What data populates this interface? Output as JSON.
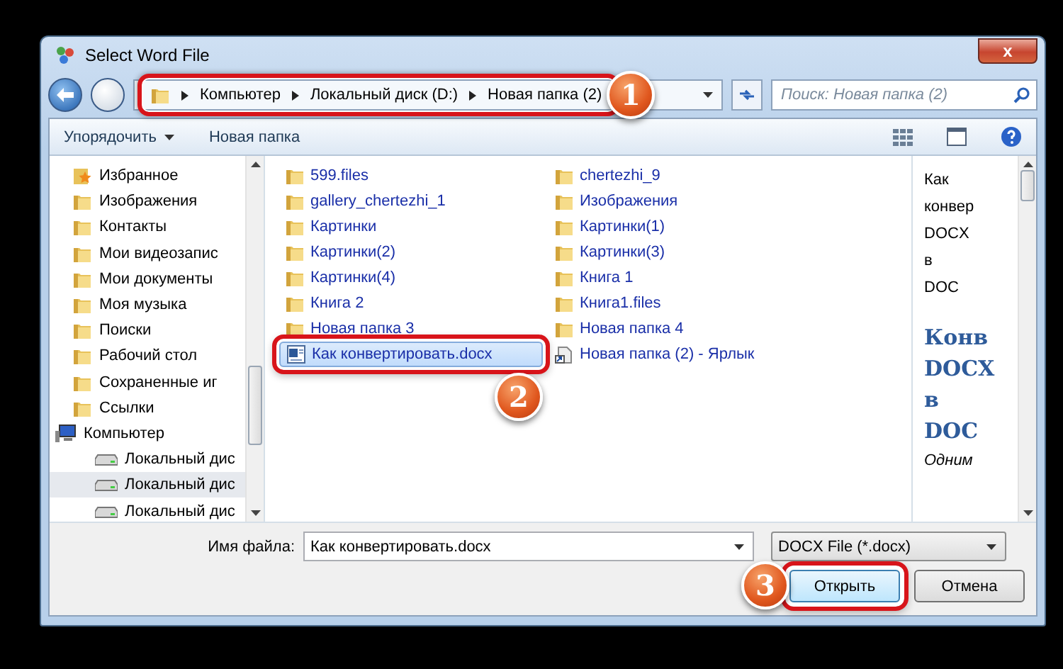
{
  "window": {
    "title": "Select Word File",
    "close": "x"
  },
  "nav": {
    "crumbs": [
      "Компьютер",
      "Локальный диск (D:)",
      "Новая папка (2)"
    ],
    "callout": "1",
    "search": {
      "placeholder": "Поиск: Новая папка (2)"
    }
  },
  "toolbar": {
    "organize": "Упорядочить",
    "new_folder": "Новая папка"
  },
  "sidebar": {
    "items": [
      {
        "label": "Избранное",
        "kind": "favorites",
        "selected": false
      },
      {
        "label": "Изображения",
        "kind": "folder",
        "selected": false
      },
      {
        "label": "Контакты",
        "kind": "folder",
        "selected": false
      },
      {
        "label": "Мои видеозапис",
        "kind": "folder",
        "selected": false
      },
      {
        "label": "Мои документы",
        "kind": "folder",
        "selected": false
      },
      {
        "label": "Моя музыка",
        "kind": "folder",
        "selected": false
      },
      {
        "label": "Поиски",
        "kind": "folder",
        "selected": false
      },
      {
        "label": "Рабочий стол",
        "kind": "folder",
        "selected": false
      },
      {
        "label": "Сохраненные иг",
        "kind": "folder",
        "selected": false
      },
      {
        "label": "Ссылки",
        "kind": "folder",
        "selected": false
      },
      {
        "label": "Компьютер",
        "kind": "computer",
        "selected": false,
        "children": [
          {
            "label": "Локальный дис",
            "kind": "drive",
            "selected": false
          },
          {
            "label": "Локальный дис",
            "kind": "drive",
            "selected": true
          },
          {
            "label": "Локальный дис",
            "kind": "drive",
            "selected": false
          }
        ]
      }
    ]
  },
  "files": [
    {
      "name": "599.files",
      "kind": "folder",
      "selected": false
    },
    {
      "name": "gallery_chertezhi_1",
      "kind": "folder",
      "selected": false
    },
    {
      "name": "Картинки",
      "kind": "folder",
      "selected": false
    },
    {
      "name": "Картинки(2)",
      "kind": "folder",
      "selected": false
    },
    {
      "name": "Картинки(4)",
      "kind": "folder",
      "selected": false
    },
    {
      "name": "Книга 2",
      "kind": "folder",
      "selected": false
    },
    {
      "name": "Новая папка 3",
      "kind": "folder",
      "selected": false
    },
    {
      "name": "Как конвертировать.docx",
      "kind": "document",
      "selected": true,
      "callout": "2"
    },
    {
      "name": "chertezhi_9",
      "kind": "folder",
      "selected": false
    },
    {
      "name": "Изображения",
      "kind": "folder",
      "selected": false
    },
    {
      "name": "Картинки(1)",
      "kind": "folder",
      "selected": false
    },
    {
      "name": "Картинки(3)",
      "kind": "folder",
      "selected": false
    },
    {
      "name": "Книга 1",
      "kind": "folder",
      "selected": false
    },
    {
      "name": "Книга1.files",
      "kind": "folder",
      "selected": false
    },
    {
      "name": "Новая папка 4",
      "kind": "folder",
      "selected": false
    },
    {
      "name": "Новая папка (2) - Ярлык",
      "kind": "shortcut",
      "selected": false
    }
  ],
  "preview": [
    {
      "text": "Как",
      "kind": "plain"
    },
    {
      "text": "конвер",
      "kind": "plain"
    },
    {
      "text": "DOCX",
      "kind": "plain"
    },
    {
      "text": "в",
      "kind": "plain"
    },
    {
      "text": "DOC",
      "kind": "plain"
    },
    {
      "text": "Конв",
      "kind": "heading"
    },
    {
      "text": "DOCX",
      "kind": "heading"
    },
    {
      "text": "в",
      "kind": "heading"
    },
    {
      "text": "DOC",
      "kind": "heading"
    },
    {
      "text": "Одним",
      "kind": "italic"
    }
  ],
  "footer": {
    "file_name_label": "Имя файла:",
    "file_name": "Как конвертировать.docx",
    "file_type": "DOCX File (*.docx)",
    "buttons": [
      {
        "label": "Открыть",
        "focused": true,
        "callout": "3"
      },
      {
        "label": "Отмена",
        "focused": false
      }
    ]
  }
}
